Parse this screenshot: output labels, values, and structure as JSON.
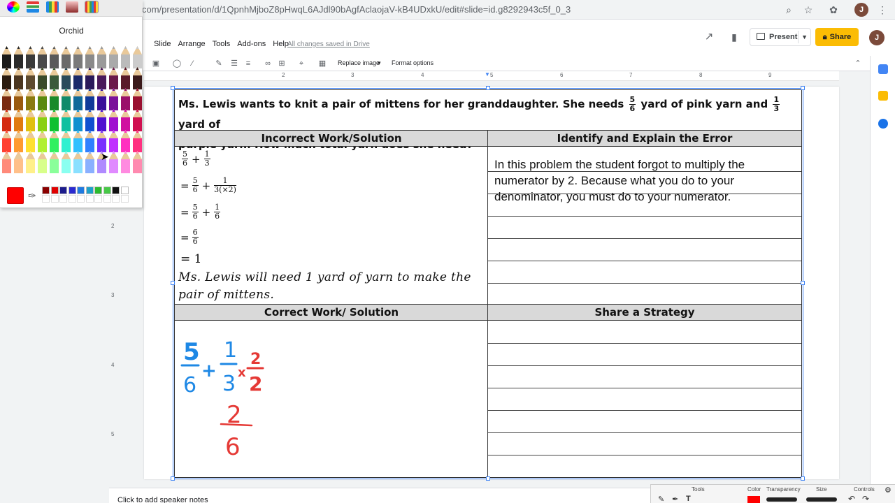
{
  "browser": {
    "url": "com/presentation/d/1QpnhMjboZ8pHwqL6AJdl90bAgfAclaojaV-kB4UDxkU/edit#slide=id.g8292943c5f_0_3",
    "profile_initial": "J"
  },
  "app": {
    "menu": [
      "Slide",
      "Arrange",
      "Tools",
      "Add-ons",
      "Help"
    ],
    "saved_status": "All changes saved in Drive",
    "present_label": "Present",
    "share_label": "Share",
    "user_initial": "J"
  },
  "toolbar": {
    "replace_image": "Replace image",
    "format_options": "Format options"
  },
  "ruler": {
    "top_numbers": [
      "2",
      "3",
      "4",
      "5",
      "6",
      "7",
      "8",
      "9"
    ],
    "left_numbers": [
      "2",
      "3",
      "4",
      "5"
    ]
  },
  "slide": {
    "problem_text_1": "Ms. Lewis wants to knit a pair of mittens for her granddaughter.  She needs",
    "problem_frac1_num": "5",
    "problem_frac1_den": "6",
    "problem_text_2": "yard of pink yarn and",
    "problem_frac2_num": "1",
    "problem_frac2_den": "3",
    "problem_text_3": "yard of",
    "problem_line2": "purple yarn.  How much total yarn does she need?",
    "headers": {
      "incorrect": "Incorrect Work/Solution",
      "identify": "Identify and Explain the Error",
      "correct": "Correct Work/ Solution",
      "strategy": "Share a Strategy"
    },
    "incorrect_work": {
      "line1": {
        "a_num": "5",
        "a_den": "6",
        "op": "+",
        "b_num": "1",
        "b_den": "3"
      },
      "line2": {
        "eq": "=",
        "a_num": "5",
        "a_den": "6",
        "op": "+",
        "b_num": "1",
        "b_den": "3(×2)"
      },
      "line3": {
        "eq": "=",
        "a_num": "5",
        "a_den": "6",
        "op": "+",
        "b_num": "1",
        "b_den": "6"
      },
      "line4": {
        "eq": "=",
        "a_num": "6",
        "a_den": "6"
      },
      "line5": "= 1"
    },
    "incorrect_conclusion": "Ms. Lewis will need 1 yard of yarn to make the pair of mittens.",
    "error_explanation": "In this problem the student forgot to multiply the numerator by 2.  Because what you do to your denominator, you must do to your numerator.",
    "handwriting": {
      "blue": [
        "5",
        "6",
        "+",
        "1",
        "3"
      ],
      "red": [
        "x",
        "2",
        "2",
        "2",
        "6"
      ]
    }
  },
  "picker": {
    "color_name": "Orchid",
    "current_color": "#ff0000",
    "swatches": [
      "#8b0000",
      "#e00000",
      "#1c1c8c",
      "#2a2ad0",
      "#1f7ae0",
      "#1ea0c8",
      "#2dbb2d",
      "#47c847",
      "#111111",
      "#ffffff"
    ]
  },
  "notes": {
    "placeholder": "Click to add speaker notes"
  },
  "drawbar": {
    "tools": "Tools",
    "color": "Color",
    "transparency": "Transparency",
    "size": "Size",
    "controls": "Controls"
  }
}
